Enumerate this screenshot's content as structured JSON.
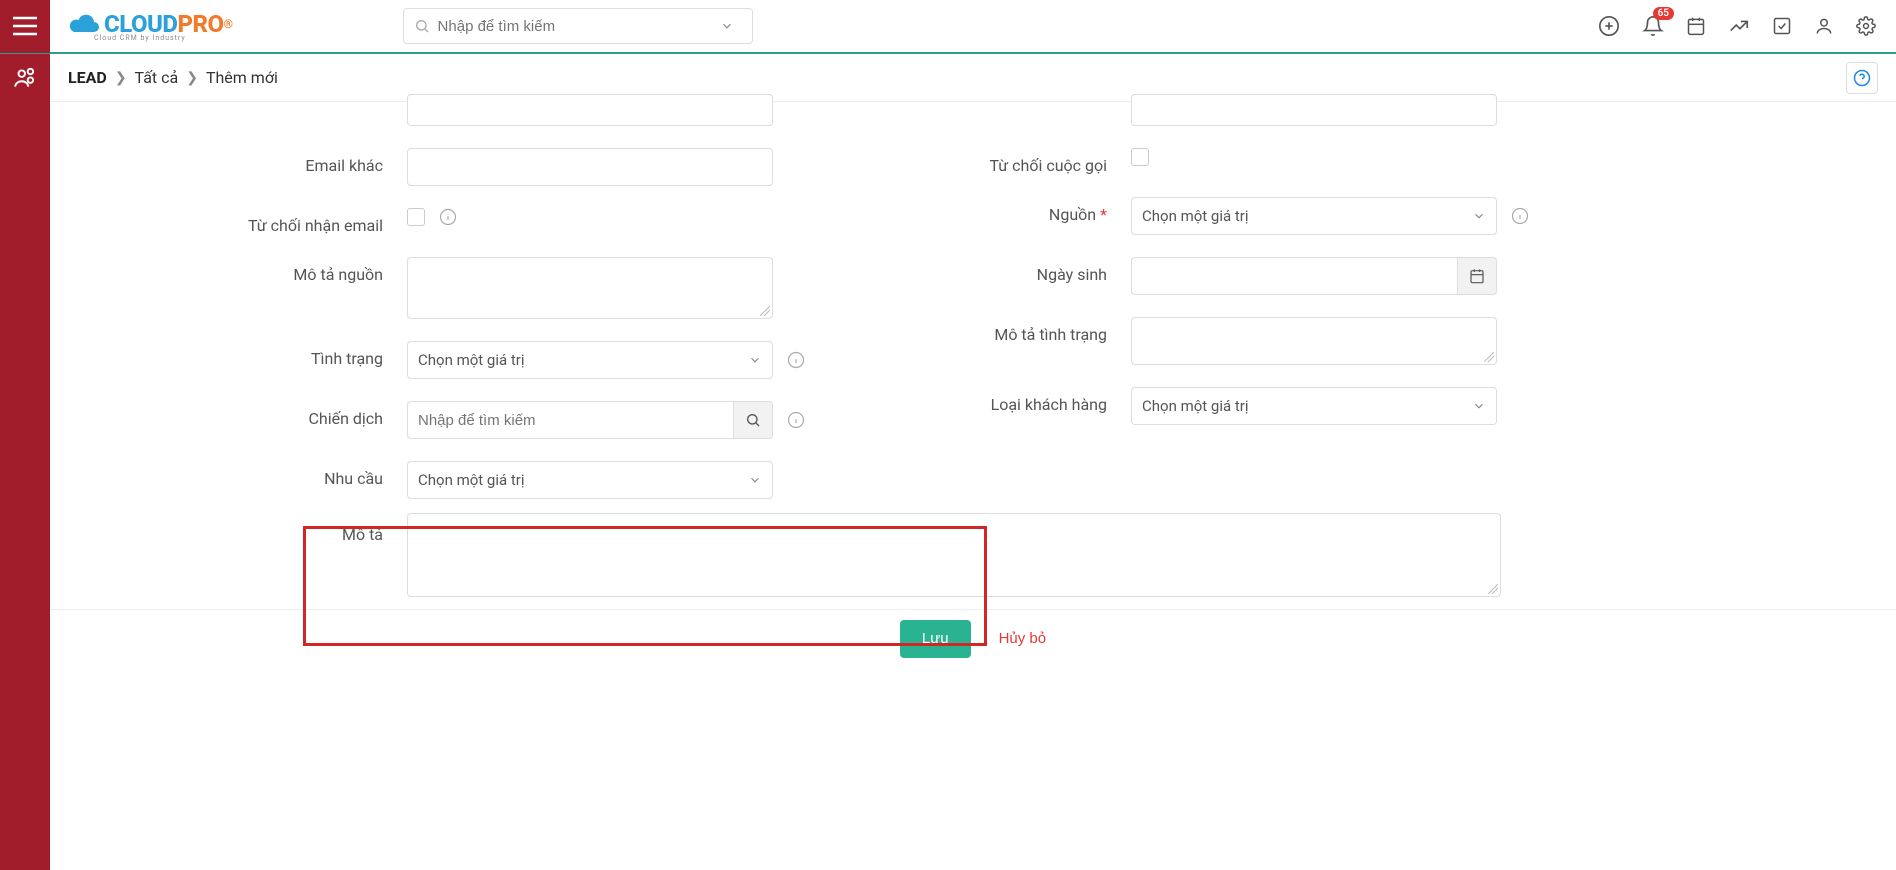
{
  "header": {
    "search_placeholder": "Nhập để tìm kiếm",
    "notification_count": "65",
    "logo_blue": "CLOUD",
    "logo_orange": "PRO",
    "logo_reg": "®",
    "logo_sub": "Cloud CRM by Industry"
  },
  "breadcrumb": {
    "root": "LEAD",
    "level1": "Tất cả",
    "level2": "Thêm mới"
  },
  "labels": {
    "email_other": "Email khác",
    "refuse_email": "Từ chối nhận email",
    "source_desc": "Mô tả nguồn",
    "status": "Tình trạng",
    "campaign": "Chiến dịch",
    "need": "Nhu cầu",
    "description": "Mô tả",
    "refuse_call": "Từ chối cuộc gọi",
    "source": "Nguồn",
    "birthday": "Ngày sinh",
    "status_desc": "Mô tả tình trạng",
    "customer_type": "Loại khách hàng"
  },
  "placeholders": {
    "select_value": "Chọn một giá trị",
    "lookup": "Nhập để tìm kiếm"
  },
  "footer": {
    "save": "Lưu",
    "cancel": "Hủy bỏ"
  }
}
